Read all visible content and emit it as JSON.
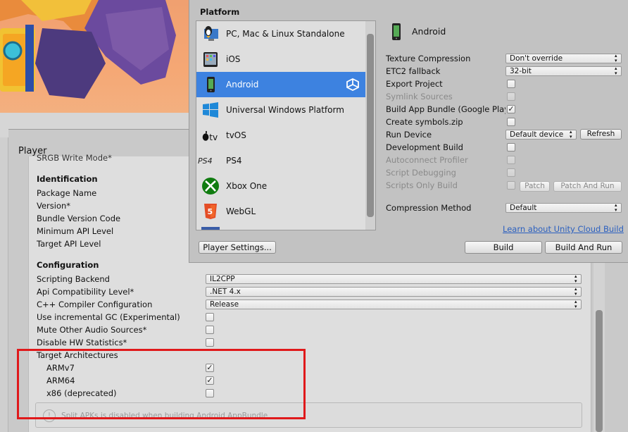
{
  "build_settings": {
    "platform_header": "Platform",
    "platforms": [
      {
        "label": "PC, Mac & Linux Standalone",
        "icon": "pc-mac-linux-icon",
        "selected": false
      },
      {
        "label": "iOS",
        "icon": "ios-icon",
        "selected": false
      },
      {
        "label": "Android",
        "icon": "android-icon",
        "selected": true
      },
      {
        "label": "Universal Windows Platform",
        "icon": "windows-icon",
        "selected": false
      },
      {
        "label": "tvOS",
        "icon": "tvos-icon",
        "selected": false
      },
      {
        "label": "PS4",
        "icon": "ps4-icon",
        "selected": false
      },
      {
        "label": "Xbox One",
        "icon": "xbox-icon",
        "selected": false
      },
      {
        "label": "WebGL",
        "icon": "html5-icon",
        "selected": false
      }
    ],
    "selected_platform_title": "Android",
    "settings": {
      "texture_compression": {
        "label": "Texture Compression",
        "value": "Don't override"
      },
      "etc2_fallback": {
        "label": "ETC2 fallback",
        "value": "32-bit"
      },
      "export_project": {
        "label": "Export Project",
        "checked": false
      },
      "symlink_sources": {
        "label": "Symlink Sources",
        "checked": false
      },
      "build_app_bundle": {
        "label": "Build App Bundle (Google Play)",
        "checked": true
      },
      "create_symbols": {
        "label": "Create symbols.zip",
        "checked": false
      },
      "run_device": {
        "label": "Run Device",
        "value": "Default device",
        "refresh": "Refresh"
      },
      "development_build": {
        "label": "Development Build",
        "checked": false
      },
      "autoconnect_profiler": {
        "label": "Autoconnect Profiler",
        "checked": false
      },
      "script_debugging": {
        "label": "Script Debugging",
        "checked": false
      },
      "scripts_only_build": {
        "label": "Scripts Only Build",
        "checked": false,
        "patch": "Patch",
        "patch_and_run": "Patch And Run"
      },
      "compression_method": {
        "label": "Compression Method",
        "value": "Default"
      }
    },
    "cloud_link": "Learn about Unity Cloud Build",
    "player_settings_button": "Player Settings...",
    "build_button": "Build",
    "build_and_run_button": "Build And Run"
  },
  "player": {
    "title": "Player",
    "srgb_write_mode": "SRGB Write Mode*",
    "identification": {
      "header": "Identification",
      "package_name": "Package Name",
      "version": "Version*",
      "bundle_version_code": "Bundle Version Code",
      "min_api": "Minimum API Level",
      "target_api": "Target API Level"
    },
    "configuration": {
      "header": "Configuration",
      "scripting_backend": {
        "label": "Scripting Backend",
        "value": "IL2CPP"
      },
      "api_compat": {
        "label": "Api Compatibility Level*",
        "value": ".NET 4.x"
      },
      "cpp_compiler": {
        "label": "C++ Compiler Configuration",
        "value": "Release"
      },
      "incremental_gc": {
        "label": "Use incremental GC (Experimental)",
        "checked": false
      },
      "mute_audio": {
        "label": "Mute Other Audio Sources*",
        "checked": false
      },
      "disable_hw_stats": {
        "label": "Disable HW Statistics*",
        "checked": false
      },
      "target_architectures": "Target Architectures",
      "armv7": {
        "label": "ARMv7",
        "checked": true
      },
      "arm64": {
        "label": "ARM64",
        "checked": true
      },
      "x86": {
        "label": "x86 (deprecated)",
        "checked": false
      },
      "split_apk_info": "Split APKs is disabled when building Android AppBundle"
    }
  },
  "colors": {
    "selection": "#3d82e0",
    "highlight_box": "#e0191b",
    "link": "#2a5fbf"
  }
}
